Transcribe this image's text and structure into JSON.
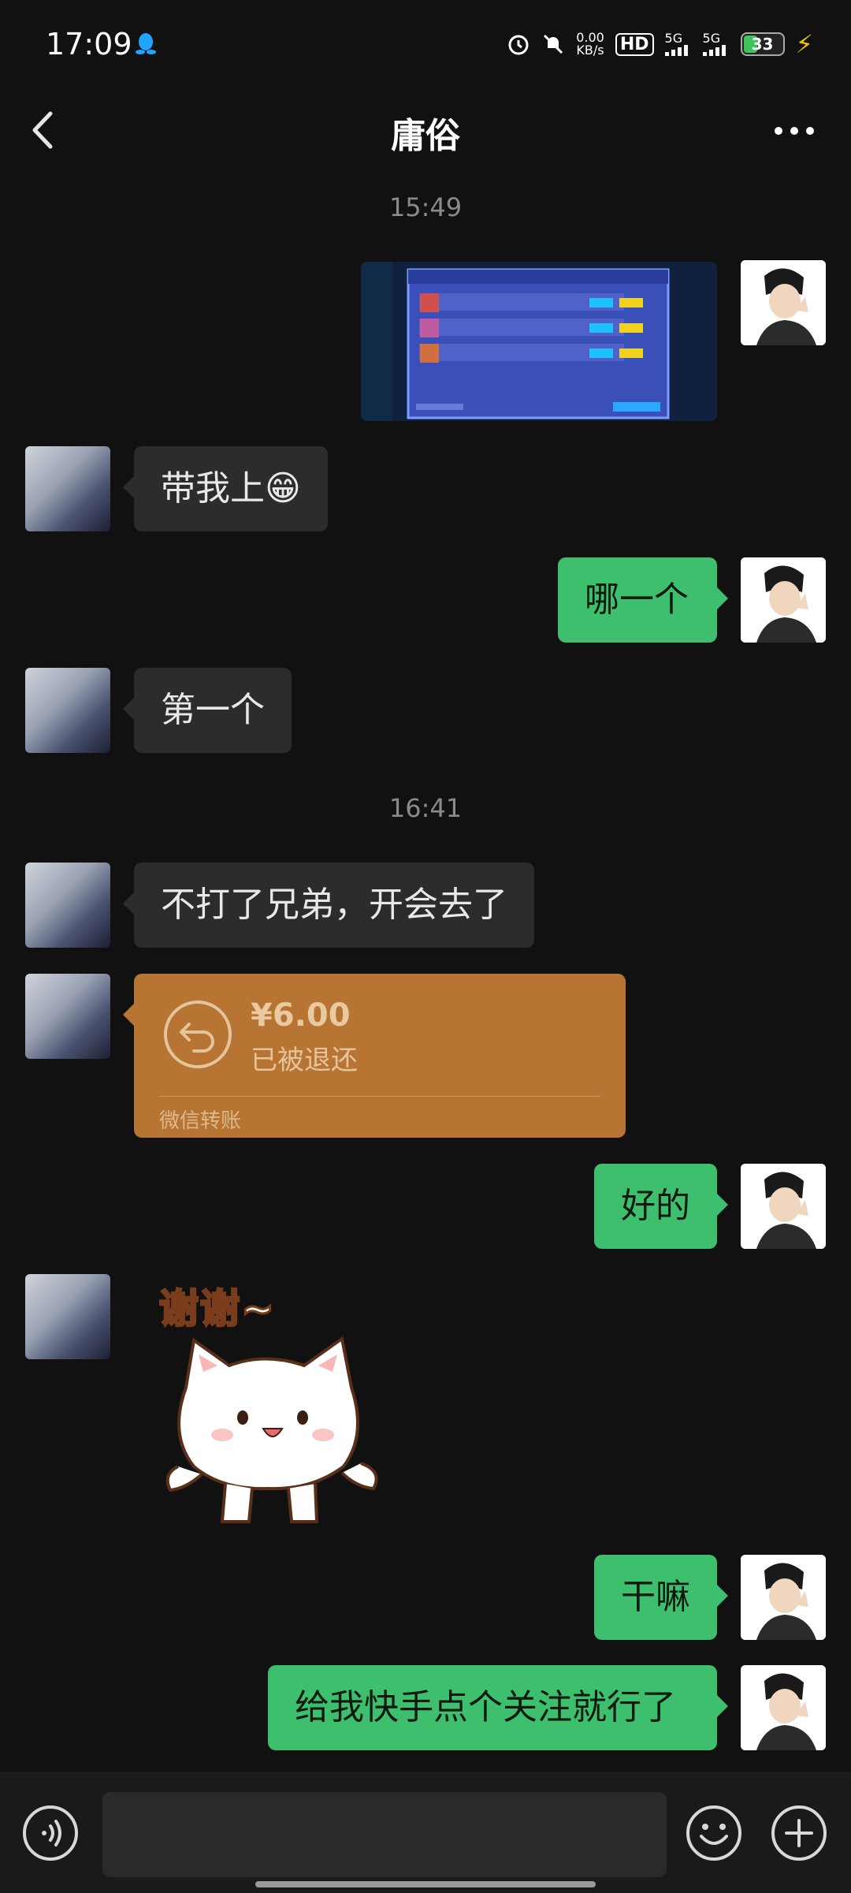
{
  "status_bar": {
    "time": "17:09",
    "net_speed_value": "0.00",
    "net_speed_unit": "KB/s",
    "hd_label": "HD",
    "sim1_label": "5G",
    "sim2_label": "5G",
    "battery_level": "33",
    "icons": [
      "qq-icon",
      "alarm-icon",
      "mute-icon",
      "signal-icon",
      "signal-icon",
      "battery-icon",
      "charging-icon"
    ]
  },
  "header": {
    "title": "庸俗",
    "back_icon": "chevron-left-icon",
    "more_icon": "more-icon"
  },
  "messages": [
    {
      "type": "timestamp",
      "text": "15:49"
    },
    {
      "type": "image",
      "sender": "me"
    },
    {
      "type": "text",
      "sender": "other",
      "text": "带我上😁"
    },
    {
      "type": "text",
      "sender": "me",
      "text": "哪一个"
    },
    {
      "type": "text",
      "sender": "other",
      "text": "第一个"
    },
    {
      "type": "timestamp",
      "text": "16:41"
    },
    {
      "type": "text",
      "sender": "other",
      "text": "不打了兄弟，开会去了"
    },
    {
      "type": "transfer",
      "sender": "other",
      "amount": "¥6.00",
      "status": "已被退还",
      "label": "微信转账"
    },
    {
      "type": "text",
      "sender": "me",
      "text": "好的"
    },
    {
      "type": "sticker",
      "sender": "other",
      "text": "谢谢~"
    },
    {
      "type": "text",
      "sender": "me",
      "text": "干嘛"
    },
    {
      "type": "text",
      "sender": "me",
      "text": "给我快手点个关注就行了"
    }
  ],
  "input_bar": {
    "icons": [
      "voice-icon",
      "emoji-icon",
      "plus-icon"
    ],
    "value": ""
  },
  "colors": {
    "background": "#111111",
    "bubble_in": "#2c2c2c",
    "bubble_out": "#3ebf6d",
    "transfer_card": "#b77432"
  }
}
